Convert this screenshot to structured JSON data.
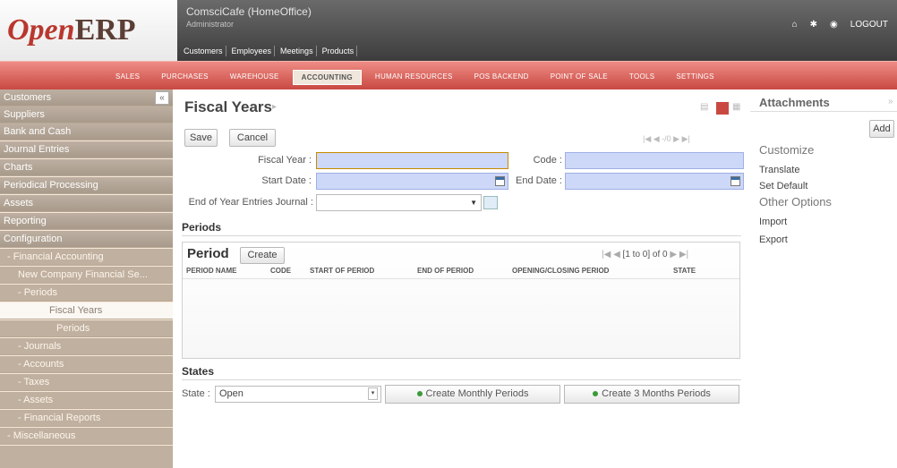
{
  "logo": {
    "open": "Open",
    "erp": "ERP"
  },
  "header": {
    "company": "ComsciCafe (HomeOffice)",
    "user": "Administrator",
    "shortcuts": [
      "Customers",
      "Employees",
      "Meetings",
      "Products"
    ],
    "logout": "LOGOUT"
  },
  "menu": {
    "items": [
      "SALES",
      "PURCHASES",
      "WAREHOUSE",
      "ACCOUNTING",
      "HUMAN RESOURCES",
      "POS BACKEND",
      "POINT OF SALE",
      "TOOLS",
      "SETTINGS"
    ],
    "active": "ACCOUNTING"
  },
  "sidebar": {
    "collapse_icon": "«",
    "items": [
      "Customers",
      "Suppliers",
      "Bank and Cash",
      "Journal Entries",
      "Charts",
      "Periodical Processing",
      "Assets",
      "Reporting",
      "Configuration",
      "- Financial Accounting",
      "New Company Financial Se...",
      "- Periods",
      "Fiscal Years",
      "Periods",
      "- Journals",
      "- Accounts",
      "- Taxes",
      "- Assets",
      "- Financial Reports",
      "- Miscellaneous"
    ]
  },
  "form": {
    "title": "Fiscal Years",
    "save": "Save",
    "cancel": "Cancel",
    "pager": "|◀ ◀ -/0 ▶ ▶|",
    "fiscal_year_label": "Fiscal Year :",
    "code_label": "Code :",
    "start_date_label": "Start Date :",
    "end_date_label": "End Date :",
    "journal_label": "End of Year Entries Journal :",
    "periods_section": "Periods",
    "period_title": "Period",
    "create": "Create",
    "period_pager_prev": "|◀ ◀",
    "period_pager_text": "[1 to 0] of 0",
    "period_pager_next": "▶ ▶|",
    "columns": [
      "PERIOD NAME",
      "CODE",
      "START OF PERIOD",
      "END OF PERIOD",
      "OPENING/CLOSING PERIOD",
      "STATE"
    ],
    "states_section": "States",
    "state_label": "State :",
    "state_value": "Open",
    "create_monthly": "Create Monthly Periods",
    "create_3months": "Create 3 Months Periods"
  },
  "rightpanel": {
    "attachments": "Attachments",
    "collapse": "»",
    "add": "Add",
    "customize": "Customize",
    "translate": "Translate",
    "set_default": "Set Default",
    "other_options": "Other Options",
    "import": "Import",
    "export": "Export"
  },
  "colors": {
    "accent": "#c94942",
    "sidebar": "#a89a8b",
    "input": "#cdd7f7"
  }
}
